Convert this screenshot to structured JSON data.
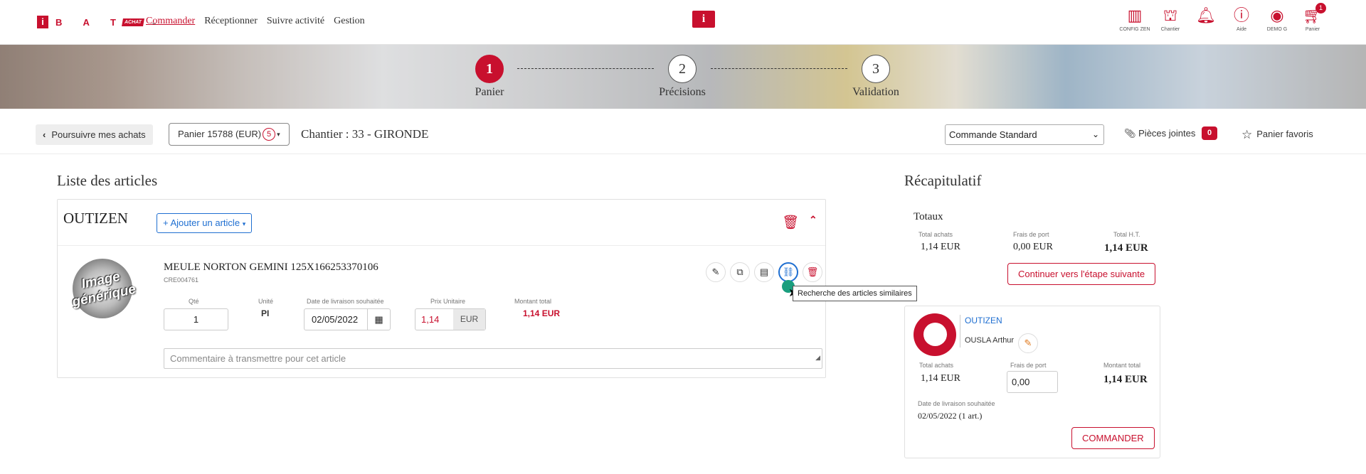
{
  "nav": {
    "logo_letters": "B A T",
    "logo_i": "i",
    "logo_achat": "ACHAT",
    "menu": [
      "Commander",
      "Réceptionner",
      "Suivre activité",
      "Gestion"
    ],
    "center_logo": "i",
    "right": [
      {
        "icon": "building-icon",
        "label": "CONFIG ZEN"
      },
      {
        "icon": "crane-icon",
        "label": "Chantier"
      },
      {
        "icon": "bell-icon",
        "label": ""
      },
      {
        "icon": "help-icon",
        "label": "Aide"
      },
      {
        "icon": "user-icon",
        "label": "DEMO G"
      },
      {
        "icon": "cart-icon",
        "label": "Panier"
      }
    ],
    "cart_count": "1"
  },
  "steps": [
    {
      "num": "1",
      "label": "Panier"
    },
    {
      "num": "2",
      "label": "Précisions"
    },
    {
      "num": "3",
      "label": "Validation"
    }
  ],
  "toolbar": {
    "back": "Poursuivre mes achats",
    "panier": "Panier 15788 (EUR)",
    "panier_count": "5",
    "chantier": "Chantier : 33 - GIRONDE",
    "order_type": "Commande Standard",
    "attachments": "Pièces jointes",
    "attachments_count": "0",
    "favorites": "Panier favoris"
  },
  "articles": {
    "title": "Liste des articles",
    "supplier": "OUTIZEN",
    "add_button": "Ajouter un article",
    "image_text_1": "Image",
    "image_text_2": "générique",
    "product_name": "MEULE NORTON GEMINI 125X166253370106",
    "product_ref": "CRE004761",
    "labels": {
      "qty": "Qté",
      "unit": "Unité",
      "date": "Date de livraison souhaitée",
      "price": "Prix Unitaire",
      "total": "Montant total"
    },
    "qty": "1",
    "unit": "PI",
    "date": "02/05/2022",
    "price": "1,14",
    "currency": "EUR",
    "total": "1,14 EUR",
    "comment_placeholder": "Commentaire à transmettre pour cet article",
    "tooltip": "Recherche des articles similaires"
  },
  "recap": {
    "title": "Récapitulatif",
    "totaux": "Totaux",
    "labels": {
      "achats": "Total achats",
      "port": "Frais de port",
      "ht": "Total H.T.",
      "montant": "Montant total",
      "date": "Date de livraison souhaitée"
    },
    "total_achats": "1,14 EUR",
    "frais_port": "0,00 EUR",
    "total_ht": "1,14 EUR",
    "next_button": "Continuer vers l'étape suivante",
    "supplier": "OUTIZEN",
    "person": "OUSLA Arthur",
    "s_total_achats": "1,14 EUR",
    "s_frais_port": "0,00",
    "s_montant": "1,14 EUR",
    "s_date": "02/05/2022 (1 art.)",
    "order_button": "COMMANDER"
  }
}
